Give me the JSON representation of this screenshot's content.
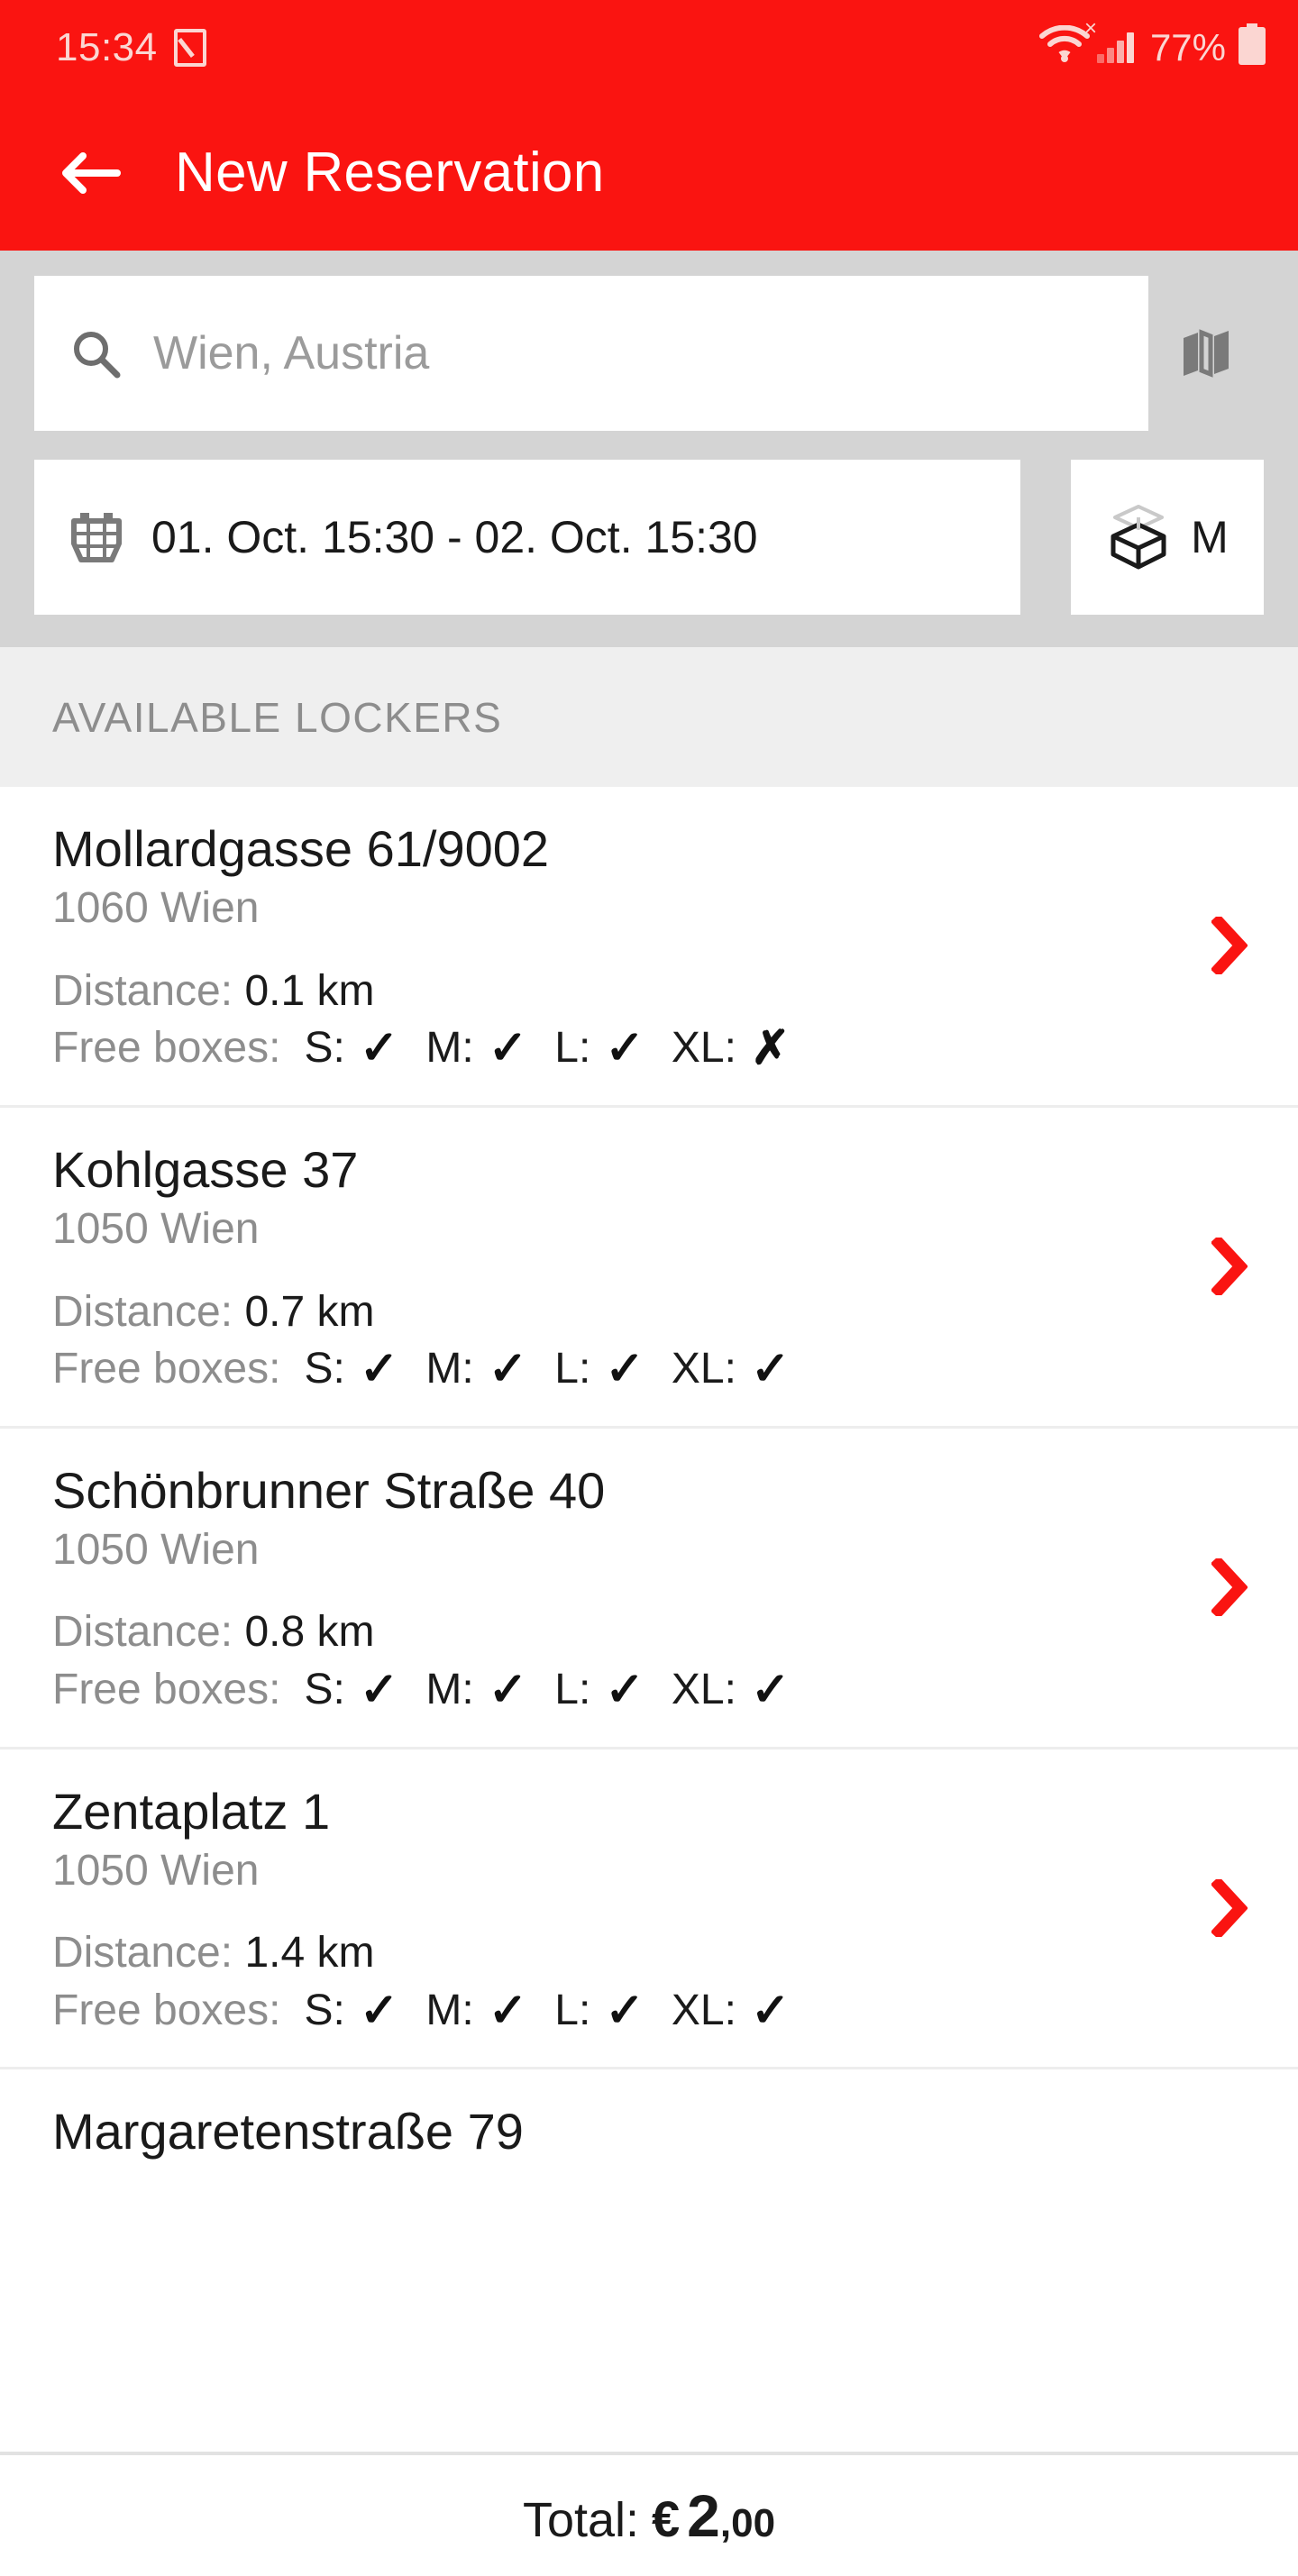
{
  "status_bar": {
    "time": "15:34",
    "screenshot_icon": "screenshot-edit-icon",
    "wifi_icon": "wifi-icon",
    "signal_icon": "cellular-signal-icon",
    "signal_badge": "×",
    "battery_percent": "77%",
    "battery_icon": "battery-icon",
    "bar_color": "#FA1411",
    "text_color": "#FBD6D2"
  },
  "app_bar": {
    "back_icon": "back-arrow-icon",
    "title": "New Reservation",
    "background": "#FA1411",
    "title_color": "#FFFFFF"
  },
  "search_panel": {
    "background": "#D4D4D4",
    "search": {
      "icon": "search-icon",
      "value": "",
      "placeholder": "Wien, Austria"
    },
    "map_button": {
      "icon": "map-icon",
      "label": ""
    },
    "date_field": {
      "icon": "calendar-icon",
      "value": "01. Oct. 15:30 - 02. Oct. 15:30"
    },
    "size_button": {
      "icon": "box-open-icon",
      "label": "M"
    }
  },
  "section": {
    "title": "AVAILABLE LOCKERS",
    "background": "#EFEFEF",
    "text_color": "#8D8D8D"
  },
  "labels": {
    "distance_label": "Distance:",
    "free_boxes_label": "Free boxes:",
    "check_mark": "✓",
    "cross_mark": "✗",
    "chevron_icon": "chevron-right-icon",
    "chevron_color": "#FA1411"
  },
  "lockers": [
    {
      "name": "Mollardgasse 61/9002",
      "city": "1060 Wien",
      "distance": "0.1 km",
      "boxes": [
        {
          "size": "S:",
          "available": true
        },
        {
          "size": "M:",
          "available": true
        },
        {
          "size": "L:",
          "available": true
        },
        {
          "size": "XL:",
          "available": false
        }
      ]
    },
    {
      "name": "Kohlgasse 37",
      "city": "1050 Wien",
      "distance": "0.7 km",
      "boxes": [
        {
          "size": "S:",
          "available": true
        },
        {
          "size": "M:",
          "available": true
        },
        {
          "size": "L:",
          "available": true
        },
        {
          "size": "XL:",
          "available": true
        }
      ]
    },
    {
      "name": "Schönbrunner Straße 40",
      "city": "1050 Wien",
      "distance": "0.8 km",
      "boxes": [
        {
          "size": "S:",
          "available": true
        },
        {
          "size": "M:",
          "available": true
        },
        {
          "size": "L:",
          "available": true
        },
        {
          "size": "XL:",
          "available": true
        }
      ]
    },
    {
      "name": "Zentaplatz 1",
      "city": "1050 Wien",
      "distance": "1.4 km",
      "boxes": [
        {
          "size": "S:",
          "available": true
        },
        {
          "size": "M:",
          "available": true
        },
        {
          "size": "L:",
          "available": true
        },
        {
          "size": "XL:",
          "available": true
        }
      ]
    },
    {
      "name": "Margaretenstraße 79",
      "city": "",
      "distance": "",
      "boxes": [],
      "partial": true
    }
  ],
  "total_bar": {
    "label": "Total:",
    "currency": "€",
    "amount_integer": "2",
    "amount_decimal": ",00"
  }
}
